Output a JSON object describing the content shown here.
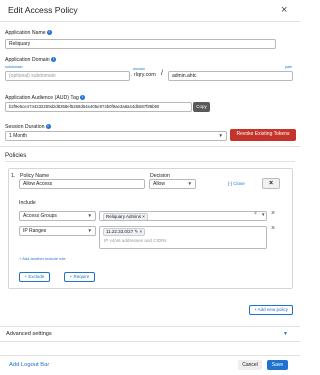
{
  "dialog": {
    "title": "Edit Access Policy",
    "close_glyph": "×"
  },
  "app_name": {
    "label": "Application Name",
    "value": "Reliquary"
  },
  "app_domain": {
    "label": "Application Domain",
    "subdomain_label": "subdomain",
    "subdomain_placeholder": "(optional) subdomain",
    "domain_label": "domain",
    "domain_value": "rlqry.com",
    "path_label": "path",
    "path_value": "admin.ahtc"
  },
  "aud_tag": {
    "label": "Application Audience (AUD) Tag",
    "value": "b2f9e5ce4744232259d2d8368ef5268d54e405e874b0f9ae3a8a44db687f89b90",
    "copy_label": "Copy"
  },
  "session": {
    "label": "Session Duration",
    "value": "1 Month",
    "revoke_label": "Revoke Existing Tokens"
  },
  "policies": {
    "heading": "Policies",
    "index": "1.",
    "name_label": "Policy Name",
    "name_value": "Allow Access",
    "decision_label": "Decision",
    "decision_value": "Allow",
    "close_label": "[-] Close",
    "include_label": "Include",
    "rules": [
      {
        "selector": "Access Groups",
        "pill": "Reliquary Admins ×",
        "input_placeholder": ""
      },
      {
        "selector": "IP Ranges",
        "pill": "11.22.33.0/27",
        "input_placeholder": "IP v4/v6 addresses and CIDRs"
      }
    ],
    "add_include_label": "+ Add another include rule",
    "exclude_label": "+ Exclude",
    "require_label": "+ Require",
    "add_policy_label": "+ Add new policy"
  },
  "advanced": {
    "label": "Advanced settings"
  },
  "footer": {
    "logout_label": "Add Logout Bar",
    "cancel_label": "Cancel",
    "save_label": "Save"
  },
  "colors": {
    "accent": "#1f72d0",
    "danger": "#c4342a"
  }
}
